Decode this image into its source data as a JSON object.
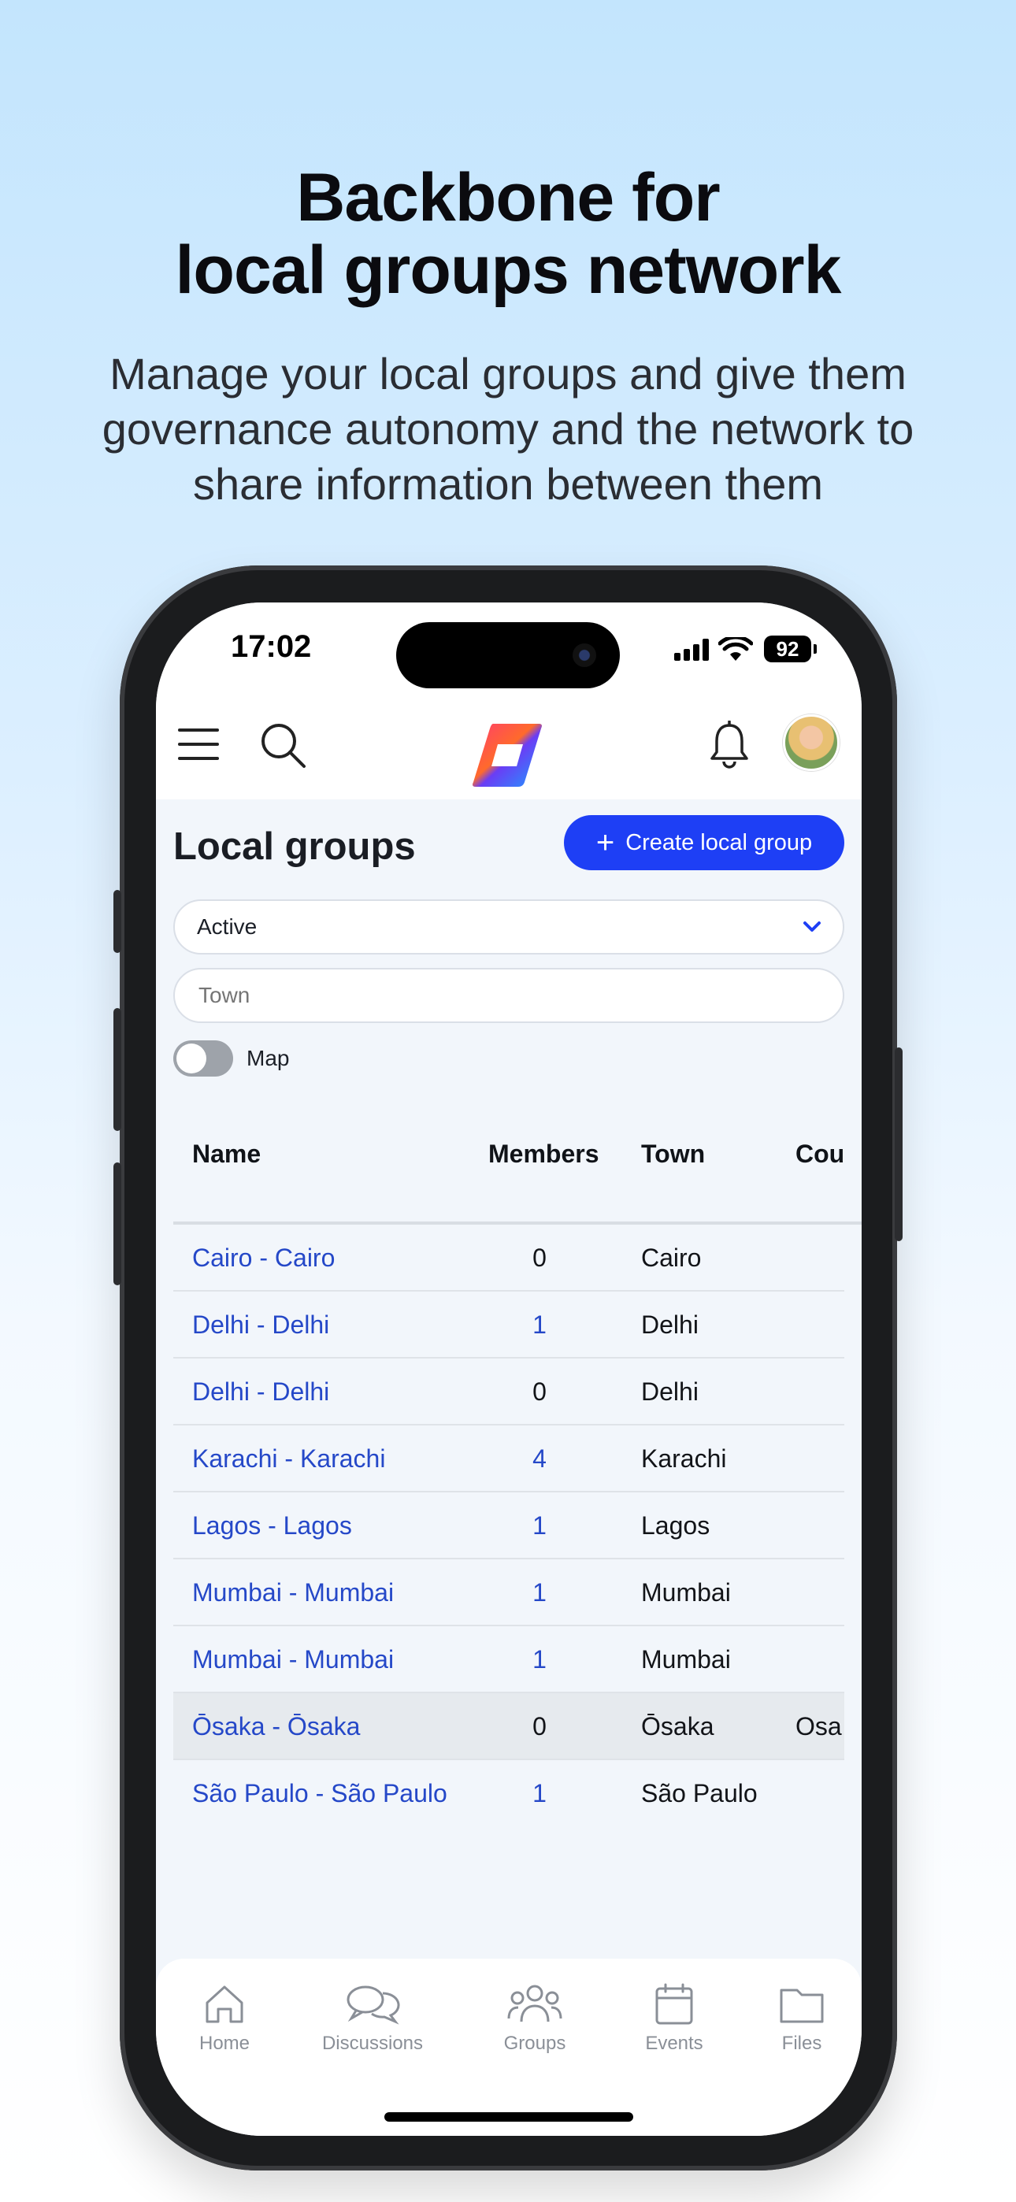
{
  "promo": {
    "headline_line1": "Backbone for",
    "headline_line2": "local groups network",
    "subtitle": "Manage your local groups and give them governance autonomy and the network to share information between them"
  },
  "status_bar": {
    "time": "17:02",
    "battery": "92"
  },
  "page": {
    "title": "Local groups",
    "create_button": "Create local group",
    "status_filter": "Active",
    "town_placeholder": "Town",
    "map_toggle_label": "Map",
    "map_toggle_on": false
  },
  "table": {
    "columns": [
      "Name",
      "Members",
      "Town",
      "Cou"
    ],
    "rows": [
      {
        "name": "Cairo - Cairo",
        "members": "0",
        "town": "Cairo",
        "country": ""
      },
      {
        "name": "Delhi - Delhi",
        "members": "1",
        "town": "Delhi",
        "country": ""
      },
      {
        "name": "Delhi - Delhi",
        "members": "0",
        "town": "Delhi",
        "country": ""
      },
      {
        "name": "Karachi - Karachi",
        "members": "4",
        "town": "Karachi",
        "country": ""
      },
      {
        "name": "Lagos - Lagos",
        "members": "1",
        "town": "Lagos",
        "country": ""
      },
      {
        "name": "Mumbai - Mumbai",
        "members": "1",
        "town": "Mumbai",
        "country": ""
      },
      {
        "name": "Mumbai - Mumbai",
        "members": "1",
        "town": "Mumbai",
        "country": ""
      },
      {
        "name": "Ōsaka - Ōsaka",
        "members": "0",
        "town": "Ōsaka",
        "country": "Osa"
      },
      {
        "name": "São Paulo - São Paulo",
        "members": "1",
        "town": "São Paulo",
        "country": ""
      }
    ]
  },
  "tabbar": {
    "items": [
      {
        "label": "Home",
        "icon": "home-icon"
      },
      {
        "label": "Discussions",
        "icon": "discussions-icon"
      },
      {
        "label": "Groups",
        "icon": "groups-icon"
      },
      {
        "label": "Events",
        "icon": "calendar-icon"
      },
      {
        "label": "Files",
        "icon": "folder-icon"
      }
    ]
  },
  "colors": {
    "accent": "#1e3ff5",
    "link": "#2548c8",
    "background_top": "#c3e5fd"
  }
}
